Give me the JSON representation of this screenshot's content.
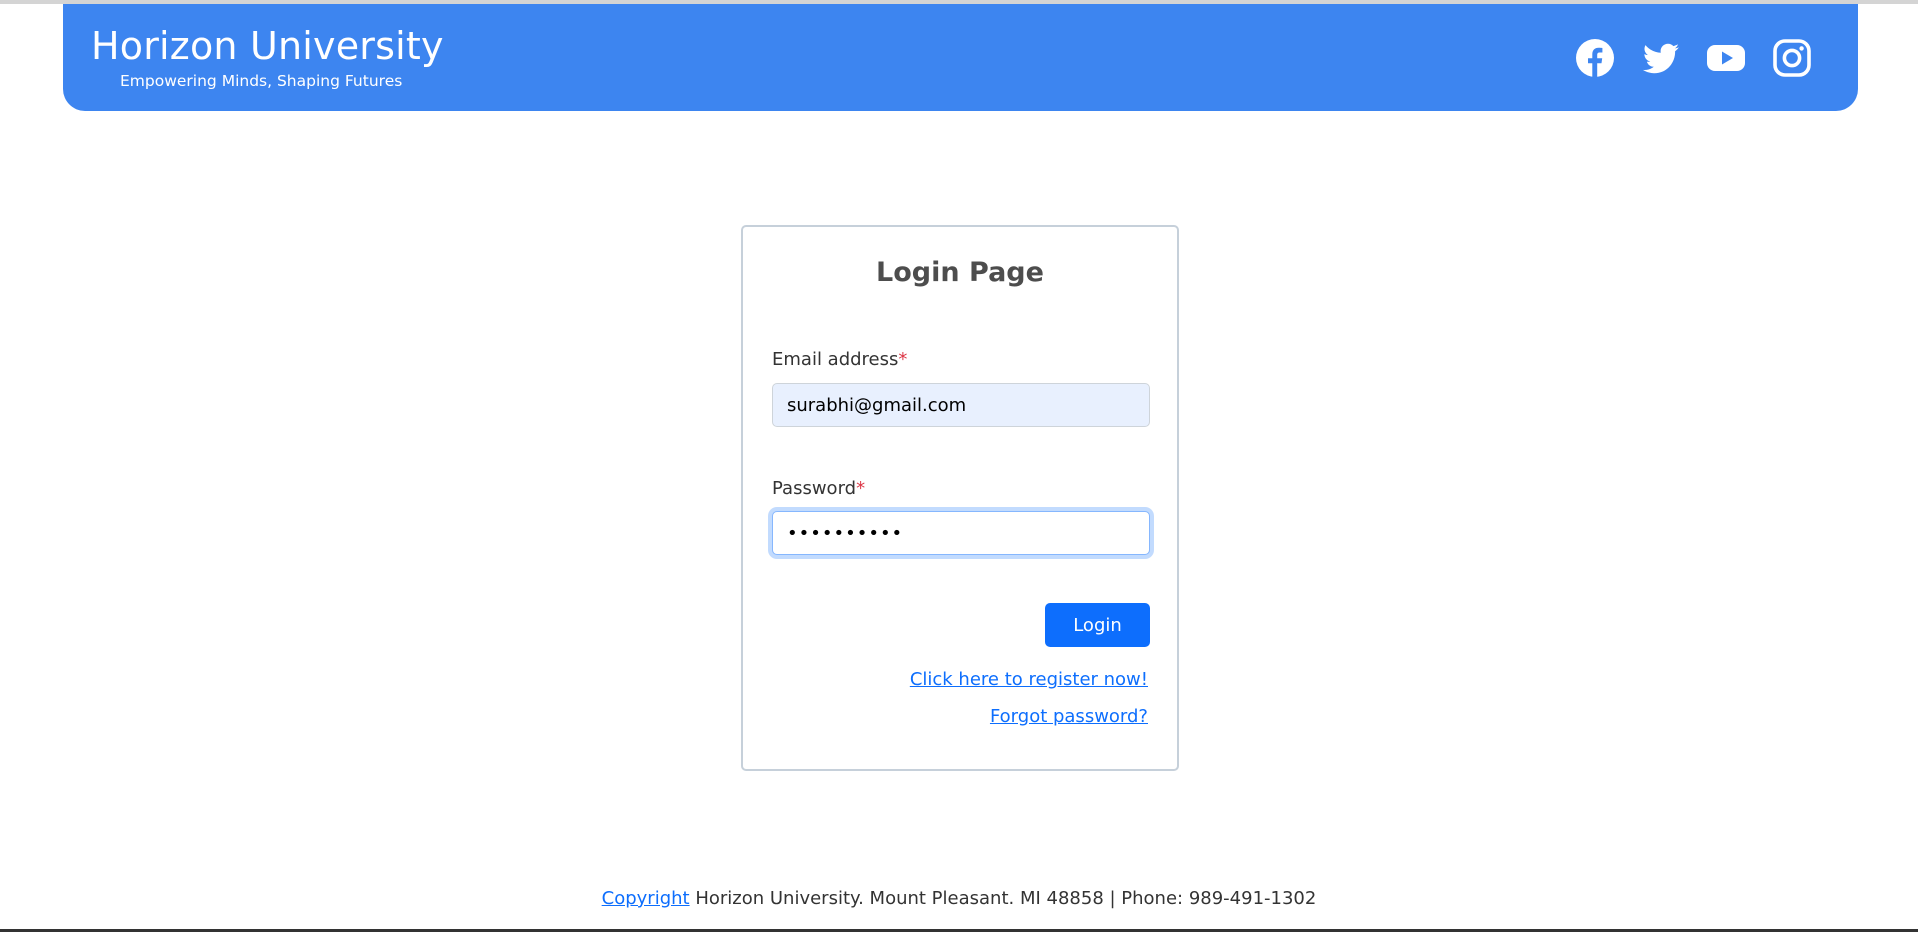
{
  "header": {
    "title": "Horizon University",
    "tagline": "Empowering Minds, Shaping Futures",
    "social": [
      "facebook-icon",
      "twitter-icon",
      "youtube-icon",
      "instagram-icon"
    ],
    "bg_color": "#3d85f0"
  },
  "login": {
    "title": "Login Page",
    "email_label": "Email address",
    "password_label": "Password",
    "required_marker": "*",
    "email_value": "surabhi@gmail.com",
    "password_value": "••••••••••",
    "login_button": "Login",
    "register_link": "Click here to register now!",
    "forgot_link": "Forgot password?"
  },
  "footer": {
    "copyright_link": "Copyright",
    "text": " Horizon University. Mount Pleasant. MI 48858 | Phone: 989-491-1302"
  },
  "colors": {
    "primary": "#0d6efd",
    "required": "#dc3545"
  }
}
